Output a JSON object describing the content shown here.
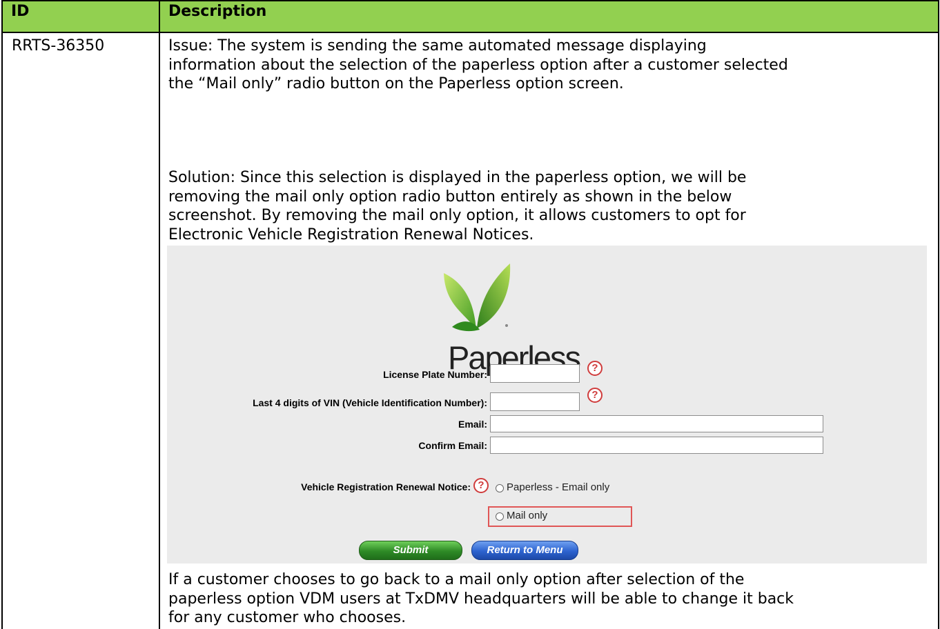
{
  "table": {
    "headers": {
      "id": "ID",
      "description": "Description"
    },
    "row": {
      "id": "RRTS-36350",
      "issue_lines": [
        "Issue: The system is sending the same automated message displaying",
        "information about the selection of the paperless option after a customer selected",
        "the “Mail only” radio button on the Paperless option screen."
      ],
      "solution_lines": [
        "Solution: Since this selection is displayed in the paperless option, we will be",
        "removing the mail only option radio button entirely as shown in the below",
        "screenshot. By removing the mail only option, it allows customers to opt for",
        "Electronic Vehicle Registration Renewal Notices."
      ],
      "closing_lines": [
        "If a customer chooses to go back to a mail only option after selection of the",
        "paperless option VDM users at TxDMV headquarters will be able to change it back",
        "for any customer who chooses."
      ]
    }
  },
  "screenshot": {
    "logo_text": "Paperless",
    "fields": {
      "plate_label": "License Plate Number:",
      "vin_label": "Last 4 digits of VIN (Vehicle Identification Number):",
      "email_label": "Email:",
      "confirm_email_label": "Confirm Email:"
    },
    "help_glyph": "?",
    "notice_label": "Vehicle Registration Renewal Notice:",
    "radio_options": [
      "Paperless - Email only",
      "Mail only"
    ],
    "buttons": {
      "submit": "Submit",
      "return": "Return to Menu"
    }
  },
  "colors": {
    "header_bg": "#92d050",
    "highlight": "#e05555",
    "help_icon": "#d03c3c"
  }
}
